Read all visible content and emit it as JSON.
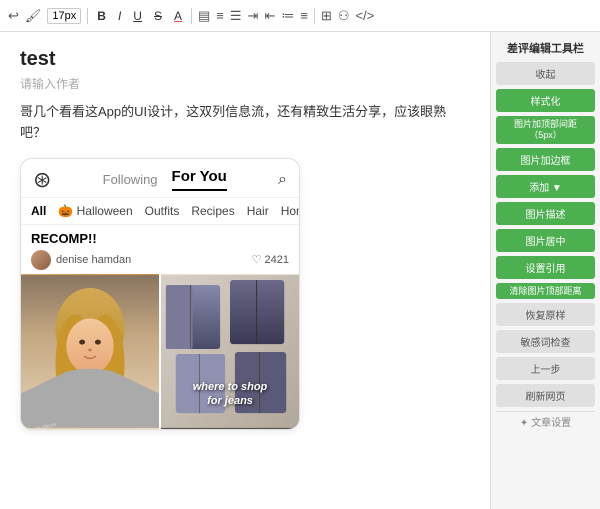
{
  "toolbar": {
    "font_size": "17px",
    "bold": "B",
    "italic": "I",
    "underline": "U",
    "strikethrough": "S",
    "font_color": "A",
    "items": [
      "B",
      "I",
      "U",
      "S",
      "A"
    ]
  },
  "editor": {
    "title": "test",
    "placeholder": "请输入作者",
    "description": "哥几个看看这App的UI设计，这双列信息流，还有精致生活分享，应该眼熟吧？"
  },
  "phone": {
    "nav": {
      "logo_symbol": "◎",
      "tab_following": "Following",
      "tab_for_you": "For You",
      "search_symbol": "⌕"
    },
    "categories": [
      {
        "label": "All",
        "active": true,
        "emoji": ""
      },
      {
        "label": "Halloween",
        "active": false,
        "emoji": "🎃"
      },
      {
        "label": "Outfits",
        "active": false,
        "emoji": ""
      },
      {
        "label": "Recipes",
        "active": false,
        "emoji": ""
      },
      {
        "label": "Hair",
        "active": false,
        "emoji": ""
      },
      {
        "label": "Home",
        "active": false,
        "emoji": ""
      }
    ],
    "post": {
      "title": "RECOMP!!",
      "author": "denise hamdan",
      "likes": "2421",
      "heart": "♡",
      "right_image_text": "where to shop\nfor jeans"
    }
  },
  "tool_panel": {
    "title": "差评编辑工具栏",
    "buttons": [
      {
        "label": "收起",
        "style": "gray"
      },
      {
        "label": "样式化",
        "style": "green"
      },
      {
        "label": "图片加顶部间距（5px）",
        "style": "green"
      },
      {
        "label": "图片加边框",
        "style": "green"
      },
      {
        "label": "添加 ▼",
        "style": "green"
      },
      {
        "label": "图片描述",
        "style": "green"
      },
      {
        "label": "图片居中",
        "style": "green"
      },
      {
        "label": "设置引用",
        "style": "green"
      },
      {
        "label": "清除图片顶部距离",
        "style": "green"
      },
      {
        "label": "恢复原样",
        "style": "gray"
      },
      {
        "label": "敏感词检查",
        "style": "gray"
      },
      {
        "label": "上一步",
        "style": "gray"
      },
      {
        "label": "刷新网页",
        "style": "gray"
      }
    ],
    "footer_label": "✦ 文章设置"
  }
}
